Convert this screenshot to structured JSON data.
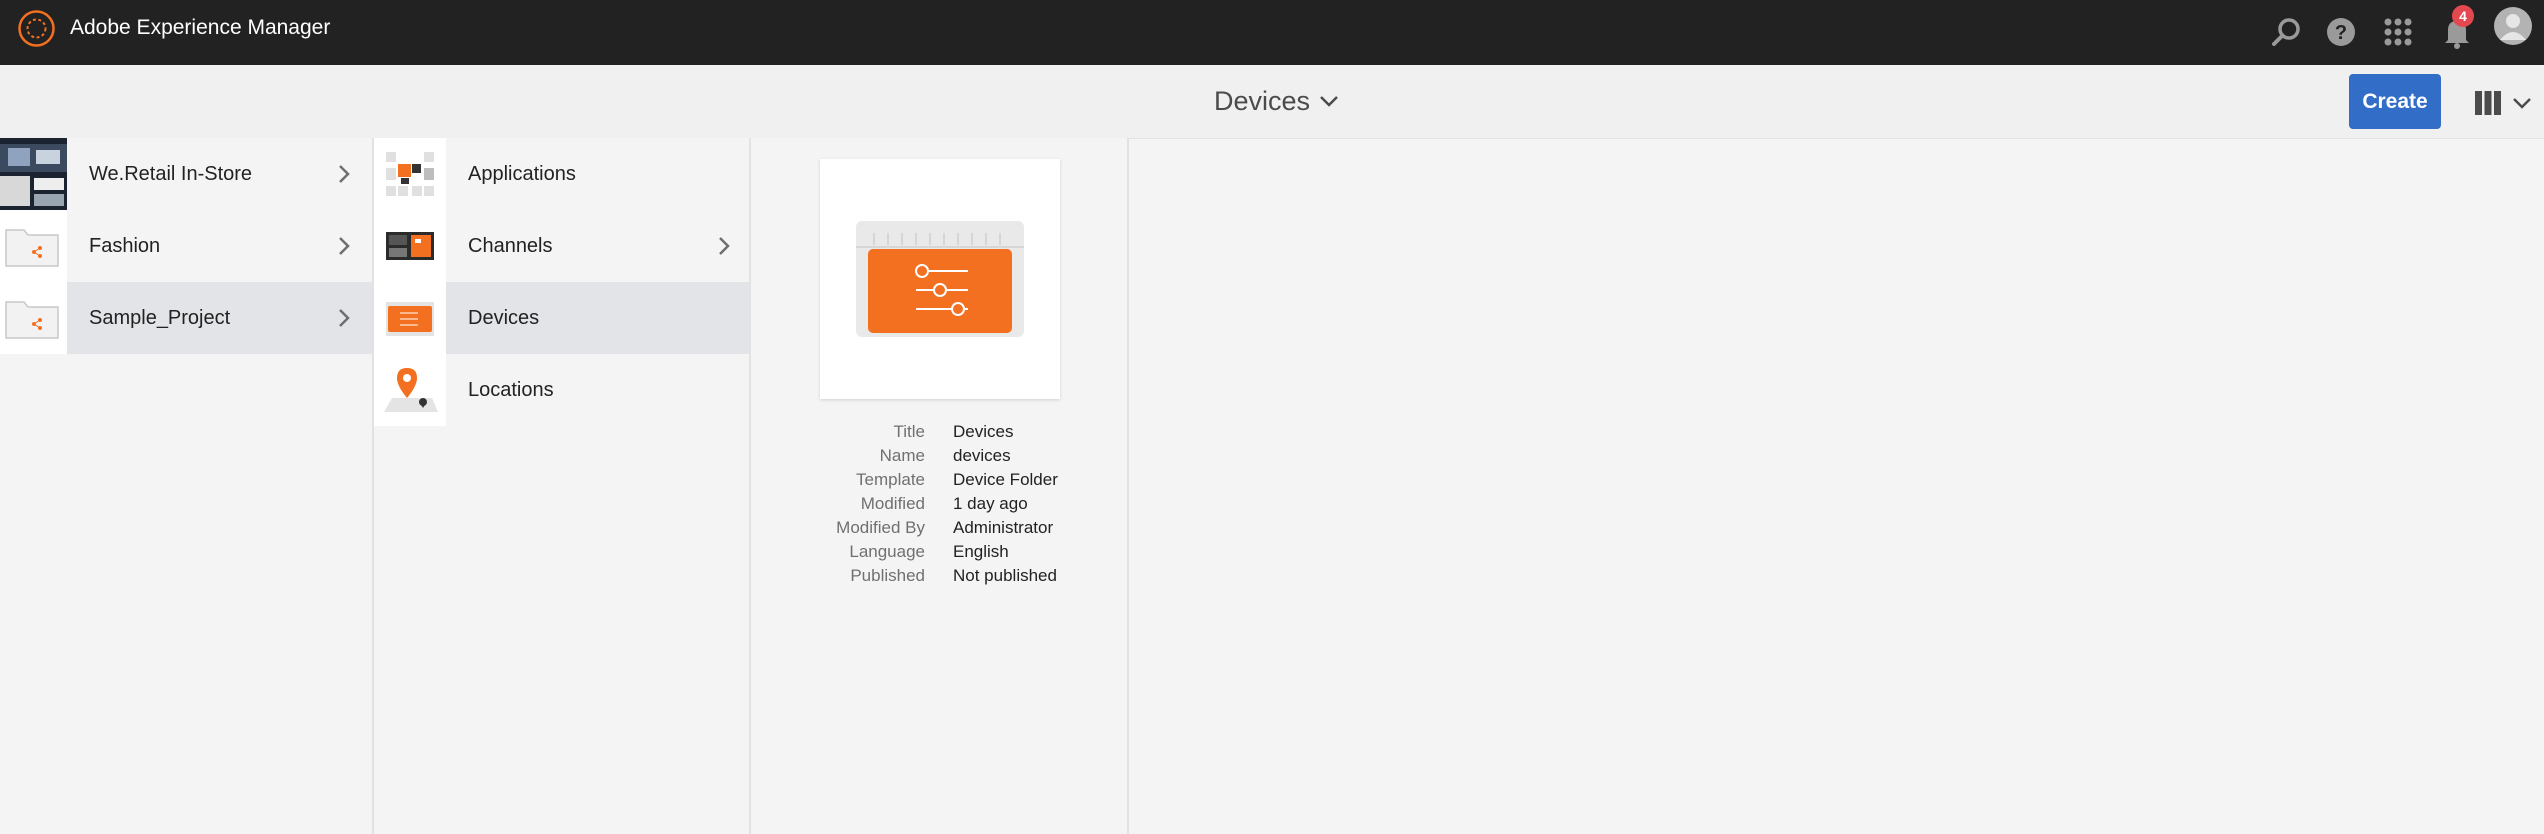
{
  "app": {
    "title": "Adobe Experience Manager",
    "notification_count": "4",
    "icons": [
      "adobe-logo-icon",
      "search-icon",
      "help-icon",
      "apps-grid-icon",
      "bell-icon",
      "user-avatar-icon"
    ]
  },
  "actionbar": {
    "location_title": "Devices",
    "create_label": "Create",
    "view_icon": "column-view-icon"
  },
  "columns": [
    {
      "items": [
        {
          "label": "We.Retail In-Store",
          "has_children": true,
          "active": false
        },
        {
          "label": "Fashion",
          "has_children": true,
          "active": false
        },
        {
          "label": "Sample_Project",
          "has_children": true,
          "active": true
        }
      ]
    },
    {
      "items": [
        {
          "label": "Applications",
          "has_children": false,
          "active": false
        },
        {
          "label": "Channels",
          "has_children": true,
          "active": false
        },
        {
          "label": "Devices",
          "has_children": false,
          "active": true
        },
        {
          "label": "Locations",
          "has_children": false,
          "active": false
        }
      ]
    }
  ],
  "preview": {
    "rows": [
      {
        "key": "Title",
        "value": "Devices"
      },
      {
        "key": "Name",
        "value": "devices"
      },
      {
        "key": "Template",
        "value": "Device Folder"
      },
      {
        "key": "Modified",
        "value": "1 day ago"
      },
      {
        "key": "Modified By",
        "value": "Administrator"
      },
      {
        "key": "Language",
        "value": "English"
      },
      {
        "key": "Published",
        "value": "Not published"
      }
    ]
  },
  "colors": {
    "topbar": "#222222",
    "accent_orange": "#f37021",
    "create_blue": "#326ec8",
    "active_row": "#e2e4e8",
    "badge_red": "#e34850"
  }
}
